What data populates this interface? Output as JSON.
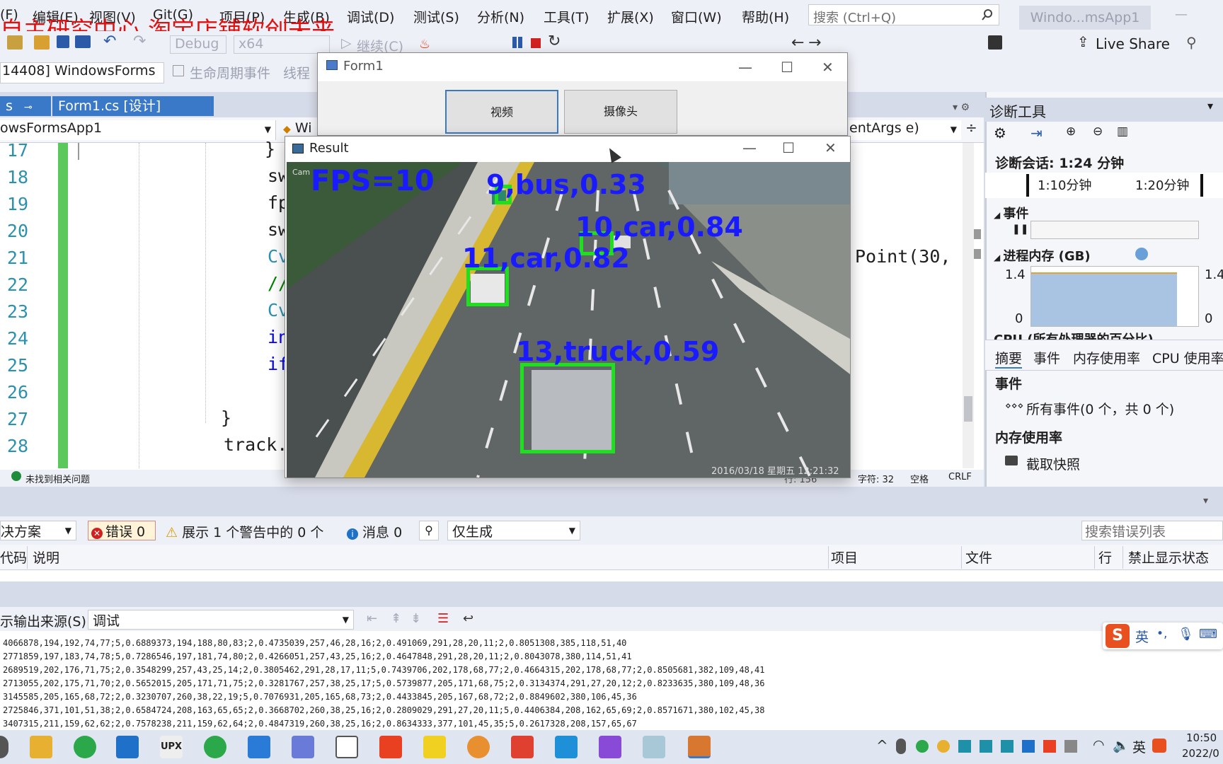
{
  "menu": {
    "items": [
      "(F)",
      "编辑(E)",
      "视图(V)",
      "Git(G)",
      "项目(P)",
      "生成(B)",
      "调试(D)",
      "测试(S)",
      "分析(N)",
      "工具(T)",
      "扩展(X)",
      "窗口(W)",
      "帮助(H)"
    ],
    "search_placeholder": "搜索 (Ctrl+Q)",
    "solution_badge": "Windo...msApp1"
  },
  "watermark": "自主研究中心-淘宝店铺软创未来",
  "toolbar": {
    "config": "Debug",
    "platform": "x64",
    "continue_label": "继续(C)",
    "live_share": "Live Share"
  },
  "row3": {
    "process": "14408] WindowsForms",
    "lifecycle": "生命周期事件",
    "thread": "线程"
  },
  "tabs": {
    "pinned": "s",
    "active": "Form1.cs [设计]"
  },
  "editor": {
    "nav_left": "owsFormsApp1",
    "nav_mid": "Wi",
    "nav_right": "entArgs e)",
    "lines": [
      {
        "n": "17",
        "code": "}"
      },
      {
        "n": "18",
        "code": "sw"
      },
      {
        "n": "19",
        "code": "fp"
      },
      {
        "n": "20",
        "code": "sw"
      },
      {
        "n": "21",
        "code": "Cv"
      },
      {
        "n": "22",
        "code": "//"
      },
      {
        "n": "23",
        "code": "Cv"
      },
      {
        "n": "24",
        "code": "in"
      },
      {
        "n": "25",
        "code": "if"
      },
      {
        "n": "26",
        "code": ""
      },
      {
        "n": "27",
        "code": "}"
      },
      {
        "n": "28",
        "code": "track."
      }
    ],
    "overflow_code": "Point(30,",
    "status_issues": "未找到相关问题",
    "status_col": "字符: 32",
    "status_space": "空格",
    "status_eol": "CRLF",
    "status_row": "行: 156"
  },
  "form1": {
    "title": "Form1",
    "btn_video": "视频",
    "btn_camera": "摄像头"
  },
  "result": {
    "title": "Result",
    "fps": "FPS=10",
    "timestamp": "2016/03/18 星期五 12:21:32",
    "cam_label": "Cam",
    "detections": [
      {
        "label": "9,bus,0.33"
      },
      {
        "label": "10,car,0.84"
      },
      {
        "label": "11,car,0.82"
      },
      {
        "label": "13,truck,0.59"
      }
    ]
  },
  "diag": {
    "title": "诊断工具",
    "session": "诊断会话: 1:24 分钟",
    "t1": "1:10分钟",
    "t2": "1:20分钟",
    "events": "事件",
    "memory": "进程内存 (GB)",
    "mem_max": "1.4",
    "mem_min": "0",
    "cpu": "CPU (所有处理器的百分比)",
    "tabs": [
      "摘要",
      "事件",
      "内存使用率",
      "CPU 使用率"
    ],
    "events_head": "事件",
    "all_events": "所有事件(0 个，共 0 个)",
    "mem_usage": "内存使用率",
    "snapshot": "截取快照"
  },
  "errors": {
    "scope": "决方案",
    "errors": "错误 0",
    "warnings": "展示 1 个警告中的 0 个",
    "messages": "消息 0",
    "build_only": "仅生成",
    "search_ph": "搜索错误列表",
    "cols": [
      "代码",
      "说明",
      "项目",
      "文件",
      "行",
      "禁止显示状态"
    ]
  },
  "output": {
    "source_label": "示输出来源(S):",
    "source_value": "调试",
    "lines": [
      "4066878,194,192,74,77;5,0.6889373,194,188,80,83;2,0.4735039,257,46,28,16;2,0.491069,291,28,20,11;2,0.8051308,385,118,51,40",
      "2771859,197,183,74,78;5,0.7286546,197,181,74,80;2,0.4266051,257,43,25,16;2,0.4647848,291,28,20,11;2,0.8043078,380,114,51,41",
      "2689519,202,176,71,75;2,0.3548299,257,43,25,14;2,0.3805462,291,28,17,11;5,0.7439706,202,178,68,77;2,0.4664315,202,178,68,77;2,0.8505681,382,109,48,41",
      "2713055,202,175,71,70;2,0.5652015,205,171,71,75;2,0.3281767,257,38,25,17;5,0.5739877,205,171,68,75;2,0.3134374,291,27,20,12;2,0.8233635,380,109,48,36",
      "3145585,205,165,68,72;2,0.3230707,260,38,22,19;5,0.7076931,205,165,68,73;2,0.4433845,205,167,68,72;2,0.8849602,380,106,45,36",
      "2725846,371,101,51,38;2,0.6584724,208,163,65,65;2,0.3668702,260,38,25,16;2,0.2809029,291,27,20,11;5,0.4406384,208,162,65,69;2,0.8571671,380,102,45,38",
      "3407315,211,159,62,62;2,0.7578238,211,159,62,64;2,0.4847319,260,38,25,16;2,0.8634333,377,101,45,35;5,0.2617328,208,157,65,67"
    ]
  },
  "taskbar": {
    "ime": "英",
    "time": "10:50",
    "date": "2022/0"
  },
  "colors": {
    "menubar": "#eef0f7",
    "accent_blue": "#3a78c8",
    "det_green": "#1fe01f",
    "det_blue": "#1a1aff"
  }
}
